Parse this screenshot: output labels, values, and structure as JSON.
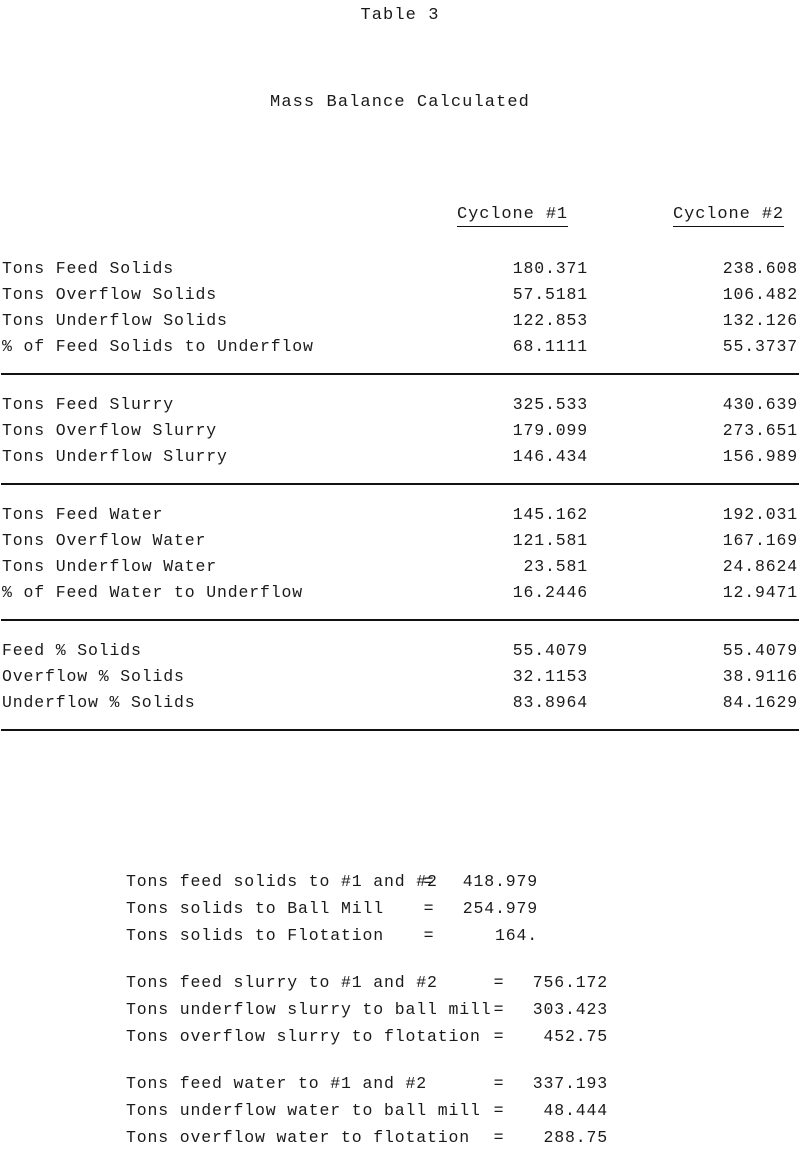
{
  "document": {
    "table_number": "Table 3",
    "title": "Mass Balance Calculated"
  },
  "columns": [
    {
      "header": "Cyclone #1"
    },
    {
      "header": "Cyclone #2"
    }
  ],
  "sections": [
    {
      "rows": [
        {
          "label": "Tons Feed Solids",
          "c1": "180.371",
          "c2": "238.608"
        },
        {
          "label": "Tons Overflow Solids",
          "c1": "57.5181",
          "c2": "106.482"
        },
        {
          "label": "Tons Underflow Solids",
          "c1": "122.853",
          "c2": "132.126"
        },
        {
          "label": "% of Feed Solids to Underflow",
          "c1": "68.1111",
          "c2": "55.3737"
        }
      ]
    },
    {
      "rows": [
        {
          "label": "Tons Feed Slurry",
          "c1": "325.533",
          "c2": "430.639"
        },
        {
          "label": "Tons Overflow Slurry",
          "c1": "179.099",
          "c2": "273.651"
        },
        {
          "label": "Tons Underflow Slurry",
          "c1": "146.434",
          "c2": "156.989"
        }
      ]
    },
    {
      "rows": [
        {
          "label": "Tons Feed Water",
          "c1": "145.162",
          "c2": "192.031"
        },
        {
          "label": "Tons Overflow Water",
          "c1": "121.581",
          "c2": "167.169"
        },
        {
          "label": "Tons Underflow Water",
          "c1": "23.581",
          "c2": "24.8624"
        },
        {
          "label": "% of Feed Water to Underflow",
          "c1": "16.2446",
          "c2": "12.9471"
        }
      ]
    },
    {
      "rows": [
        {
          "label": "Feed % Solids",
          "c1": "55.4079",
          "c2": "55.4079"
        },
        {
          "label": "Overflow % Solids",
          "c1": "32.1153",
          "c2": "38.9116"
        },
        {
          "label": "Underflow % Solids",
          "c1": "83.8964",
          "c2": "84.1629"
        }
      ]
    }
  ],
  "summary": [
    {
      "rows": [
        {
          "label": "Tons feed solids to #1 and #2",
          "eq": "=",
          "value": "418.979"
        },
        {
          "label": "Tons solids to Ball Mill",
          "eq": "=",
          "value": "254.979"
        },
        {
          "label": "Tons solids to Flotation",
          "eq": "=",
          "value": "164."
        }
      ]
    },
    {
      "rows": [
        {
          "label": "Tons feed slurry to #1 and #2",
          "eq": "=",
          "value": "756.172"
        },
        {
          "label": "Tons underflow slurry to ball mill",
          "eq": "=",
          "value": "303.423"
        },
        {
          "label": "Tons overflow slurry to flotation",
          "eq": "=",
          "value": "452.75"
        }
      ]
    },
    {
      "rows": [
        {
          "label": "Tons feed water to #1 and #2",
          "eq": "=",
          "value": "337.193"
        },
        {
          "label": "Tons underflow water to ball mill",
          "eq": "=",
          "value": "48.444"
        },
        {
          "label": "Tons overflow water to flotation",
          "eq": "=",
          "value": "288.75"
        }
      ]
    }
  ]
}
